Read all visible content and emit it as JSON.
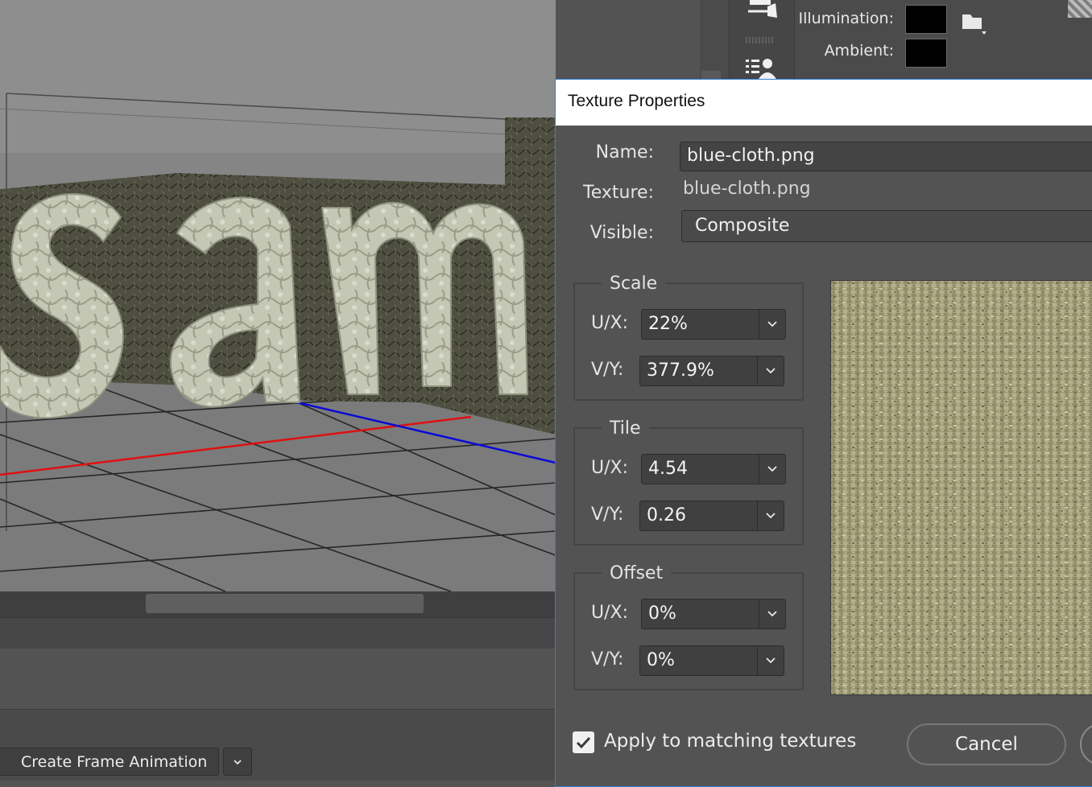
{
  "dialog": {
    "title": "Texture Properties",
    "name_label": "Name:",
    "name_value": "blue-cloth.png",
    "texture_label": "Texture:",
    "texture_value": "blue-cloth.png",
    "visible_label": "Visible:",
    "visible_value": "Composite",
    "scale": {
      "legend": "Scale",
      "ux_label": "U/X:",
      "ux_value": "22%",
      "vy_label": "V/Y:",
      "vy_value": "377.9%"
    },
    "tile": {
      "legend": "Tile",
      "ux_label": "U/X:",
      "ux_value": "4.54",
      "vy_label": "V/Y:",
      "vy_value": "0.26"
    },
    "offset": {
      "legend": "Offset",
      "ux_label": "U/X:",
      "ux_value": "0%",
      "vy_label": "V/Y:",
      "vy_value": "0%"
    },
    "apply_label": "Apply to matching textures",
    "apply_checked": true,
    "cancel_label": "Cancel"
  },
  "properties_panel": {
    "illumination_label": "Illumination:",
    "ambient_label": "Ambient:",
    "illumination_color": "#000000",
    "ambient_color": "#000000"
  },
  "viewport": {
    "text_3d": "sam",
    "x_axis_color": "#e01010",
    "z_axis_color": "#0a0ad8"
  },
  "timeline": {
    "create_button_label": "Create Frame Animation"
  },
  "colors": {
    "dialog_accent": "#2f7fd3",
    "texture_preview": "#a39f7a"
  }
}
